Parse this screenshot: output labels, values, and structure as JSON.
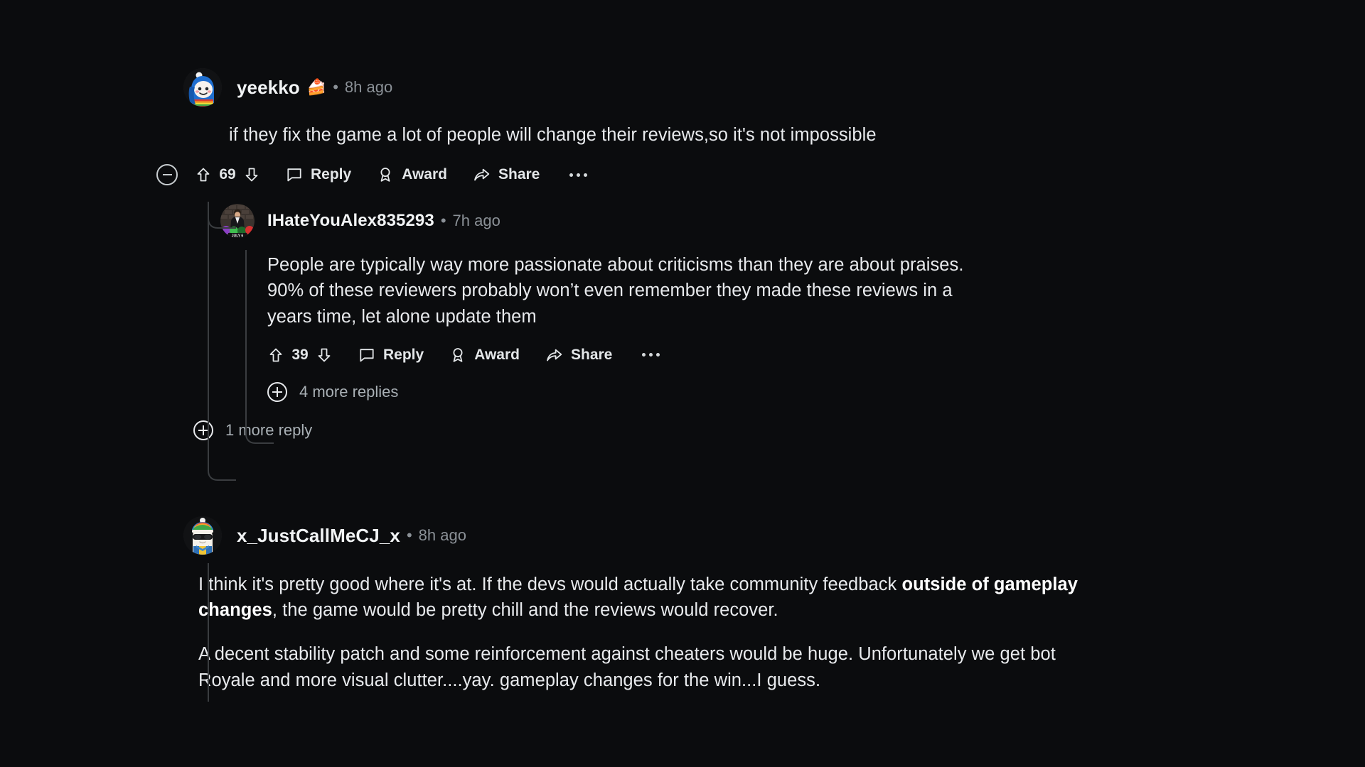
{
  "theme": {
    "background": "#0b0c0e",
    "text_primary": "#e8eaed",
    "text_muted": "#8b9197",
    "thread_line": "#3a3d40"
  },
  "action_labels": {
    "reply": "Reply",
    "award": "Award",
    "share": "Share",
    "more": "more options"
  },
  "comments": [
    {
      "id": "c1",
      "username": "yeekko",
      "badge": "cake-day",
      "badge_glyph": "🍰",
      "separator": "•",
      "timestamp": "8h ago",
      "body": "if they fix the game a lot of people will change their reviews,so it's not impossible",
      "score": "69",
      "replies": [
        {
          "id": "c1r1",
          "username": "IHateYouAlex835293",
          "separator": "•",
          "timestamp": "7h ago",
          "body": "People are typically way more passionate about criticisms than they are about praises. 90% of these reviewers probably won’t even remember they made these reviews in a years time, let alone update them",
          "score": "39",
          "expander": "4 more replies"
        }
      ],
      "expander": "1 more reply"
    },
    {
      "id": "c2",
      "username": "x_JustCallMeCJ_x",
      "separator": "•",
      "timestamp": "8h ago",
      "paragraphs": [
        {
          "parts": [
            {
              "text": "I think it's pretty good where it's at. If the devs would actually take community feedback ",
              "bold": false
            },
            {
              "text": "outside of gameplay changes",
              "bold": true
            },
            {
              "text": ", the game would be pretty chill and the reviews would recover.",
              "bold": false
            }
          ]
        },
        {
          "parts": [
            {
              "text": "A decent stability patch and some reinforcement against cheaters would be huge. Unfortunately we get bot Royale and more visual clutter....yay. gameplay changes for the win...I guess.",
              "bold": false
            }
          ]
        }
      ]
    }
  ]
}
